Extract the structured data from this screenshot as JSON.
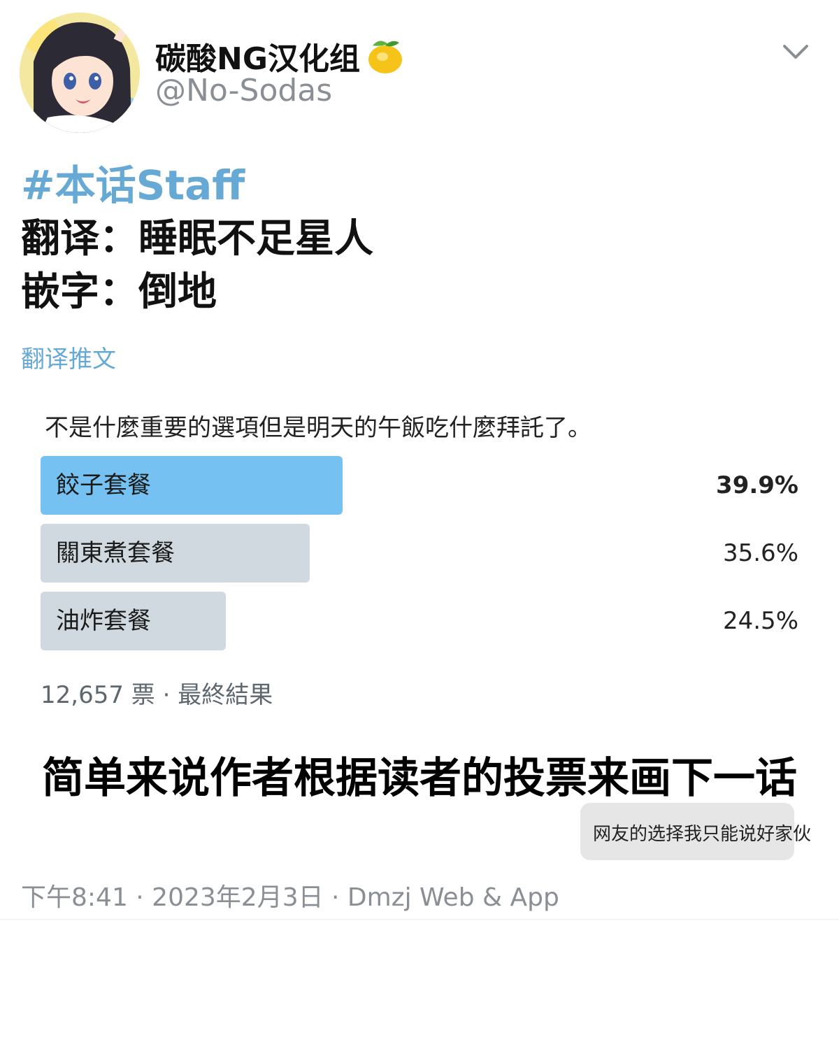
{
  "header": {
    "display_name": "碳酸NG汉化组",
    "handle": "@No-Sodas",
    "icons": [
      "avatar",
      "lemon-icon",
      "chevron-down-icon"
    ]
  },
  "tweet": {
    "hashtag": "#本话Staff",
    "credits": [
      "翻译：睡眠不足星人",
      "嵌字：倒地"
    ],
    "translate_label": "翻译推文"
  },
  "poll": {
    "question": "不是什麼重要的選項但是明天的午飯吃什麼拜託了。",
    "options": [
      {
        "label": "餃子套餐",
        "percent": "39.9%",
        "value": 39.9,
        "winner": true
      },
      {
        "label": "關東煮套餐",
        "percent": "35.6%",
        "value": 35.6,
        "winner": false
      },
      {
        "label": "油炸套餐",
        "percent": "24.5%",
        "value": 24.5,
        "winner": false
      }
    ],
    "footer": "12,657 票 · 最終結果"
  },
  "caption": "简单来说作者根据读者的投票来画下一话",
  "bubble": "网友的选择我只能说好家伙",
  "timestamp": "下午8:41 · 2023年2月3日 · Dmzj Web & App",
  "colors": {
    "accent": "#65a9d4",
    "poll_winner": "#75c1f2",
    "poll_other": "#cfd9df",
    "muted": "#8a8f95"
  }
}
